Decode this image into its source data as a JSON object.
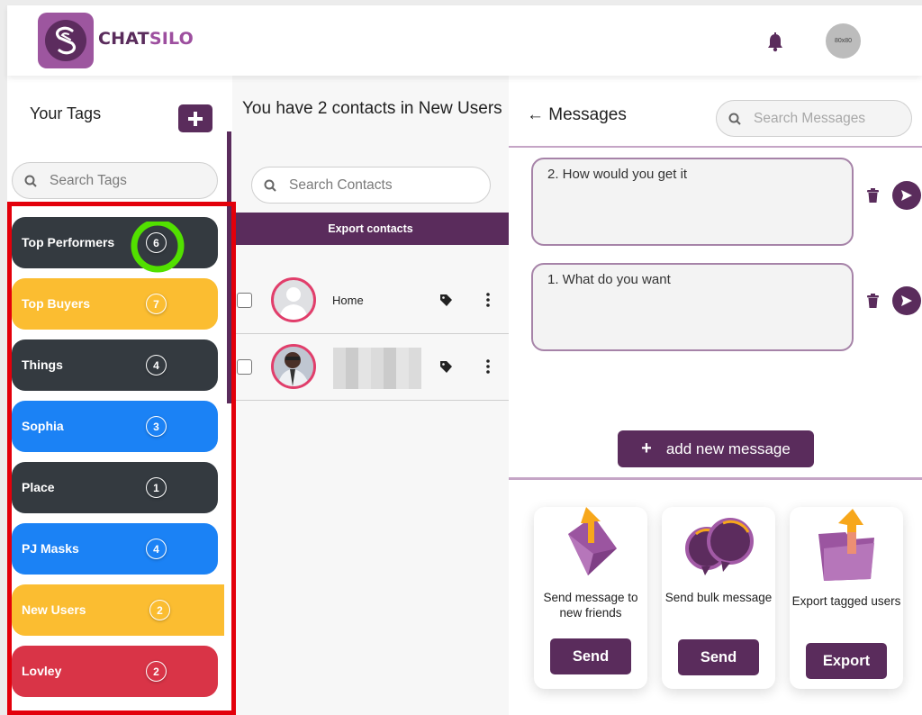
{
  "header": {
    "brand_part1": "CHAT",
    "brand_part2": "SILO",
    "avatar_placeholder": "80x80",
    "icons": {
      "notifications": "bell-icon",
      "logo": "chatsilo-logo"
    }
  },
  "tags_panel": {
    "title": "Your Tags",
    "add_button_icon": "plus-icon",
    "search_placeholder": "Search Tags",
    "tags": [
      {
        "label": "Top Performers",
        "count": "6",
        "color": "#343a40",
        "highlighted": true
      },
      {
        "label": "Top Buyers",
        "count": "7",
        "color": "#fbbd31"
      },
      {
        "label": "Things",
        "count": "4",
        "color": "#343a40"
      },
      {
        "label": "Sophia",
        "count": "3",
        "color": "#1b82f5"
      },
      {
        "label": "Place",
        "count": "1",
        "color": "#343a40"
      },
      {
        "label": "PJ Masks",
        "count": "4",
        "color": "#1b82f5"
      },
      {
        "label": "New Users",
        "count": "2",
        "color": "#fbbd31",
        "selected": true
      },
      {
        "label": "Lovley",
        "count": "2",
        "color": "#d93447"
      }
    ]
  },
  "contacts_panel": {
    "title": "You have 2 contacts in New Users",
    "search_placeholder": "Search Contacts",
    "export_label": "Export contacts",
    "contacts": [
      {
        "name": "Home",
        "avatar": "default-avatar",
        "checked": false
      },
      {
        "name": "",
        "avatar": "photo-avatar",
        "name_redacted": true,
        "checked": false
      }
    ]
  },
  "messages_panel": {
    "back_icon": "arrow-left-icon",
    "title": "Messages",
    "search_placeholder": "Search Messages",
    "messages": [
      {
        "text": "2. How would you get it"
      },
      {
        "text": "1. What do you want"
      }
    ],
    "add_message_label": "add new message",
    "actions": [
      {
        "description": "Send message to new friends",
        "button": "Send",
        "icon": "envelope-upload-icon"
      },
      {
        "description": "Send bulk message",
        "button": "Send",
        "icon": "chat-bubbles-icon"
      },
      {
        "description": "Export tagged users",
        "button": "Export",
        "icon": "folder-export-icon"
      }
    ]
  },
  "colors": {
    "brand_purple": "#5a2c5c",
    "brand_light": "#9d569f",
    "divider": "#c5a5c6",
    "annotation_red": "#e3000b",
    "annotation_green": "#52e000"
  }
}
